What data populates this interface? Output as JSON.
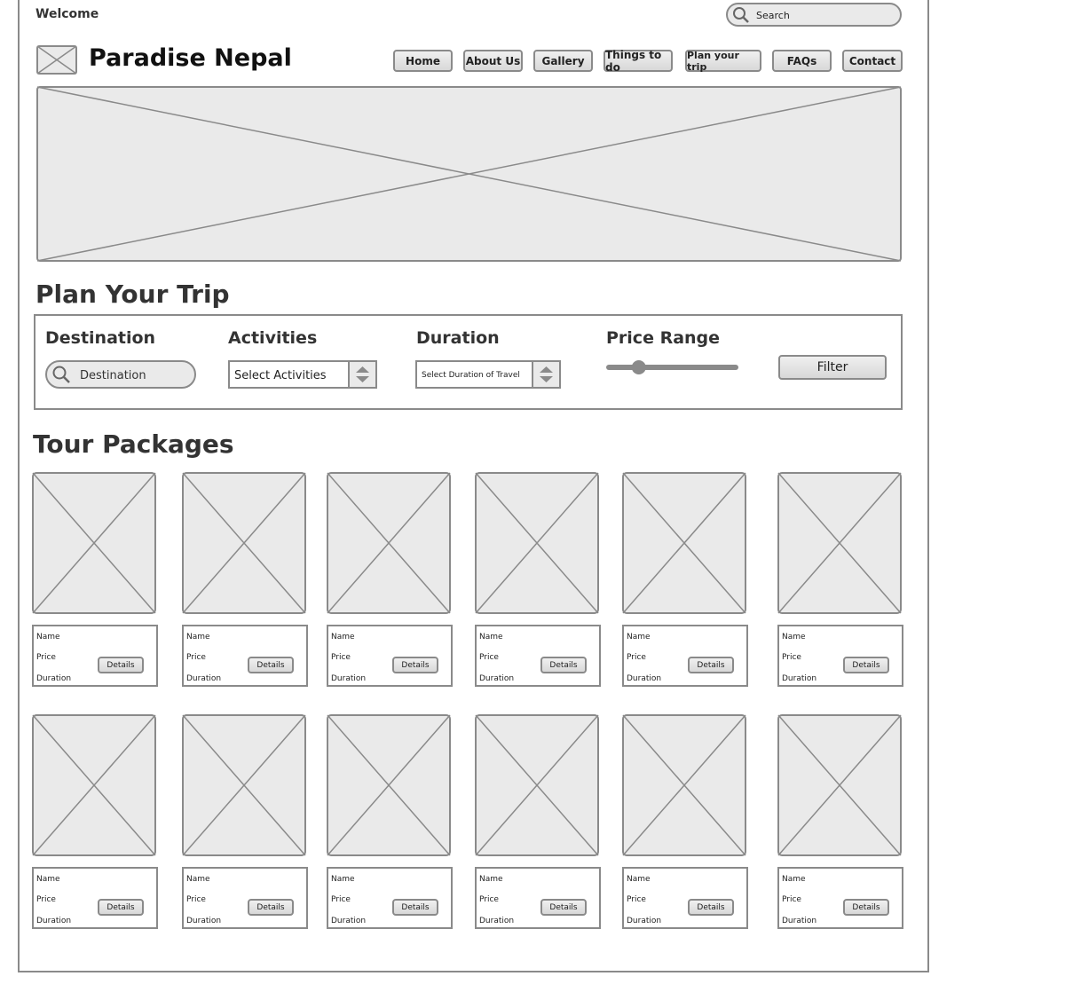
{
  "header": {
    "welcome": "Welcome",
    "search_placeholder": "Search",
    "brand": "Paradise Nepal"
  },
  "nav": [
    {
      "label": "Home"
    },
    {
      "label": "About Us"
    },
    {
      "label": "Gallery"
    },
    {
      "label": "Things to do"
    },
    {
      "label": "Plan your trip"
    },
    {
      "label": "FAQs"
    },
    {
      "label": "Contact"
    }
  ],
  "plan": {
    "title": "Plan Your Trip",
    "destination_label": "Destination",
    "destination_placeholder": "Destination",
    "activities_label": "Activities",
    "activities_value": "Select Activities",
    "duration_label": "Duration",
    "duration_value": "Select Duration of Travel",
    "price_label": "Price Range",
    "price_level": 0.25,
    "filter_button": "Filter"
  },
  "packages": {
    "title": "Tour Packages",
    "name_label": "Name",
    "price_label": "Price",
    "duration_label": "Duration",
    "details_button": "Details"
  },
  "colors": {
    "border": "#8a8a8a",
    "placeholder_fill": "#eaeaea"
  }
}
